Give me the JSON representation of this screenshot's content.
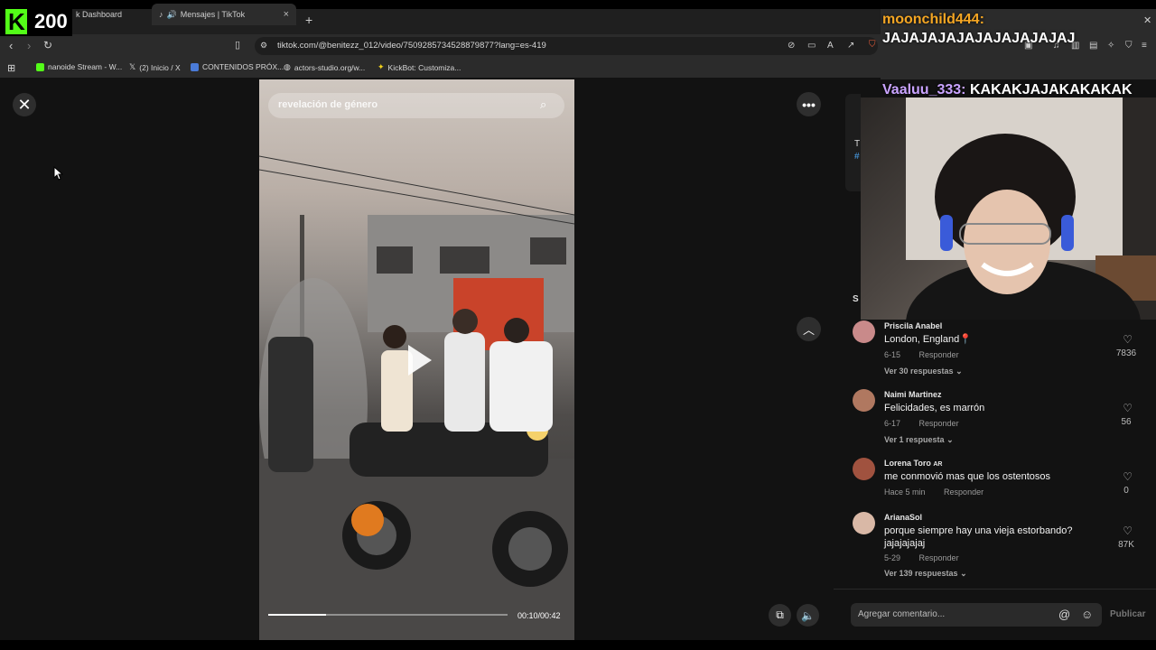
{
  "kick": {
    "count": "200"
  },
  "tabs": [
    {
      "label": "k Dashboard"
    },
    {
      "label": "Mensajes | TikTok",
      "close": "×"
    }
  ],
  "new_tab": "+",
  "address": {
    "url": "tiktok.com/@benitezz_012/video/7509285734528879877?lang=es-419"
  },
  "bookmarks": [
    {
      "label": "nanoide Stream - W...",
      "color": "#53fc18"
    },
    {
      "label": "(2) Inicio / X",
      "color": "#ffffff"
    },
    {
      "label": "CONTENIDOS PRÓX...",
      "color": "#4a7bd8"
    },
    {
      "label": "actors-studio.org/w...",
      "color": "#bbbbbb"
    },
    {
      "label": "KickBot: Customiza...",
      "color": "#f2d21b"
    }
  ],
  "video": {
    "search_text": "revelación de género",
    "time": "00:10/00:42",
    "progress": 0.24
  },
  "chat": [
    {
      "user": "moonchild444:",
      "message": "JAJAJAJAJAJAJAJAJAJAJ"
    },
    {
      "user": "Vaaluu_333:",
      "message": "KAKAKJAJAKAKAKAK"
    }
  ],
  "sidebar_partial": {
    "t1": "T",
    "t2": "#",
    "t3": "S"
  },
  "comments": [
    {
      "name": "Priscila Anabel",
      "text": "London, England📍",
      "date": "6-15",
      "reply": "Responder",
      "more": "Ver 30 respuestas",
      "likes": "7836",
      "avatar_color": "#c98a8a"
    },
    {
      "name": "Naimi Martinez",
      "text": "Felicidades, es marrón",
      "date": "6-17",
      "reply": "Responder",
      "more": "Ver 1 respuesta",
      "likes": "56",
      "avatar_color": "#b07860"
    },
    {
      "name": "Lorena Toro",
      "badge": "AR",
      "text": "me conmovió mas que los ostentosos",
      "date": "Hace 5 min",
      "reply": "Responder",
      "more": "",
      "likes": "0",
      "avatar_color": "#a0523f"
    },
    {
      "name": "ArianaSol",
      "text": "porque siempre hay una vieja estorbando? jajajajajaj",
      "date": "5-29",
      "reply": "Responder",
      "more": "Ver 139 respuestas",
      "likes": "87K",
      "avatar_color": "#d9b8a6"
    }
  ],
  "comment_input": {
    "placeholder": "Agregar comentario...",
    "publish": "Publicar"
  }
}
